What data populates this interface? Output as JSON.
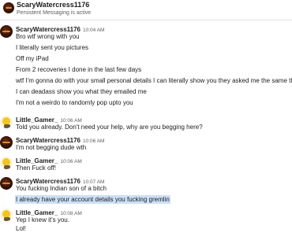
{
  "header": {
    "title": "ScaryWatercress1176",
    "status": "Persistent Messaging is active"
  },
  "messages": [
    {
      "author": "ScaryWatercress1176",
      "time": "10:04 AM",
      "avatar_icon": "dark-red-avatar-icon",
      "lines": [
        "Bro wtf wrong with you",
        "I literally sent you pictures",
        "Off my iPad",
        "From 2 recoveries I done in the last few days",
        "wtf I'm gonna do with your small personal details I can literally show you they asked me the same thing",
        "I can deadass show you what they emailed me",
        "I'm not a weirdo to randomly pop upto you"
      ]
    },
    {
      "author": "Little_Gamer_",
      "time": "10:06 AM",
      "avatar_icon": "yellow-character-avatar-icon",
      "lines": [
        "Told you already. Don't need your help, why are you begging here?"
      ]
    },
    {
      "author": "ScaryWatercress1176",
      "time": "10:06 AM",
      "avatar_icon": "dark-red-avatar-icon",
      "lines": [
        "I'm not begging dude wth"
      ]
    },
    {
      "author": "Little_Gamer_",
      "time": "10:06 AM",
      "avatar_icon": "yellow-character-avatar-icon",
      "lines": [
        "Then Fuck off!"
      ]
    },
    {
      "author": "ScaryWatercress1176",
      "time": "10:07 AM",
      "avatar_icon": "dark-red-avatar-icon",
      "lines": [
        "You fucking Indian son of a bitch",
        "I already have your account details you fucking gremlin"
      ],
      "highlighted_line": "I already have your account details you fucking gremlin"
    },
    {
      "author": "Little_Gamer_",
      "time": "10:08 AM",
      "avatar_icon": "yellow-character-avatar-icon",
      "lines": [
        "Yep I knew it's you.",
        "Lol!"
      ]
    }
  ],
  "colors": {
    "highlight": "#cce0f6",
    "secondary_text": "#616061",
    "primary_text": "#1d1c1d"
  }
}
